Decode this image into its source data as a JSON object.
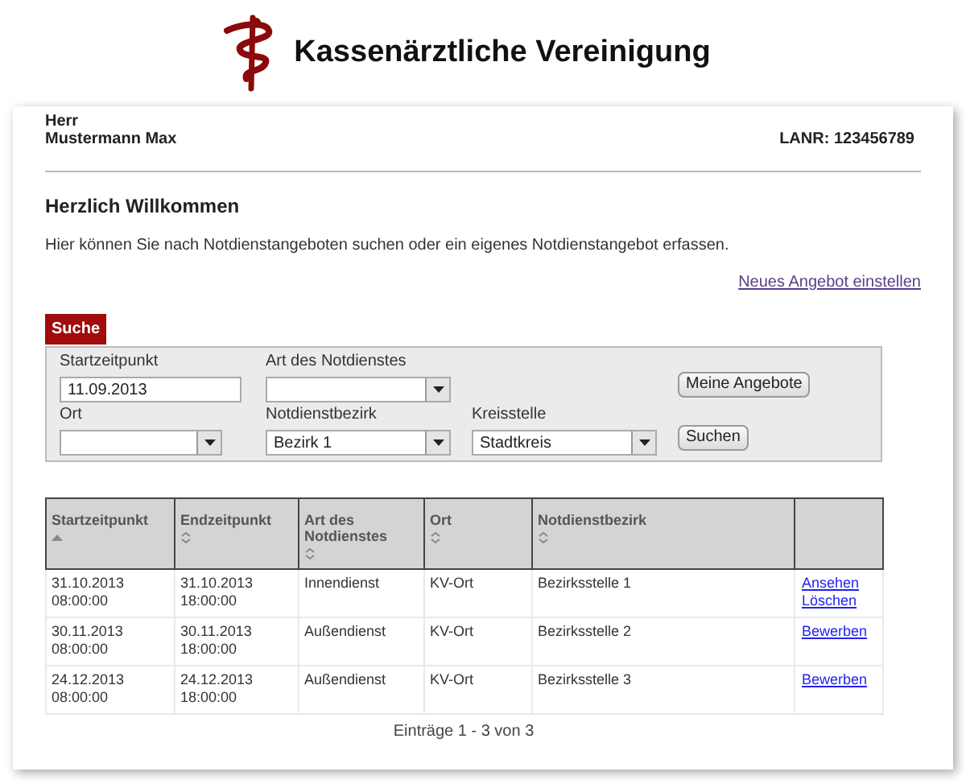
{
  "brand": {
    "name": "Kassenärztliche Vereinigung"
  },
  "user": {
    "salutation": "Herr",
    "name": "Mustermann Max",
    "lanr": "LANR: 123456789"
  },
  "heading": "Herzlich Willkommen",
  "intro": "Hier können Sie nach Notdienstangeboten suchen oder ein eigenes Notdienstangebot erfassen.",
  "new_offer_link": "Neues Angebot einstellen",
  "search": {
    "tab": "Suche",
    "rows": [
      [
        {
          "kind": "text",
          "label": "Startzeitpunkt",
          "value": "11.09.2013"
        },
        {
          "kind": "select",
          "label": "Art des Notdienstes"
        },
        "",
        {
          "kind": "button",
          "value": "Meine Angebote"
        }
      ],
      [
        {
          "kind": "select",
          "label": "Ort"
        },
        {
          "kind": "select",
          "label": "Notdienstbezirk",
          "value": "Bezirk 1"
        },
        {
          "kind": "select",
          "label": "Kreisstelle",
          "value": "Stadtkreis"
        },
        {
          "kind": "button",
          "value": "Suchen"
        }
      ]
    ]
  },
  "table": {
    "columns": [
      {
        "label": "Startzeitpunkt",
        "sorted": true
      },
      {
        "label": "Endzeitpunkt",
        "sorted": false
      },
      {
        "label": "Art des Notdienstes",
        "sorted": false
      },
      {
        "label": "Ort",
        "sorted": false
      },
      {
        "label": "Notdienstbezirk",
        "sorted": false
      },
      {}
    ],
    "rows": [
      {
        "cells": [
          "31.10.2013 08:00:00",
          "31.10.2013 18:00:00",
          "Innendienst",
          "KV-Ort",
          "Bezirksstelle 1"
        ],
        "actions": [
          "Ansehen",
          "Löschen"
        ]
      },
      {
        "cells": [
          "30.11.2013 08:00:00",
          "30.11.2013 18:00:00",
          "Außendienst",
          "KV-Ort",
          "Bezirksstelle 2"
        ],
        "actions": [
          "Bewerben"
        ]
      },
      {
        "cells": [
          "24.12.2013 08:00:00",
          "24.12.2013 18:00:00",
          "Außendienst",
          "KV-Ort",
          "Bezirksstelle 3"
        ],
        "actions": [
          "Bewerben"
        ]
      }
    ],
    "footer": "Einträge 1 - 3 von 3"
  }
}
